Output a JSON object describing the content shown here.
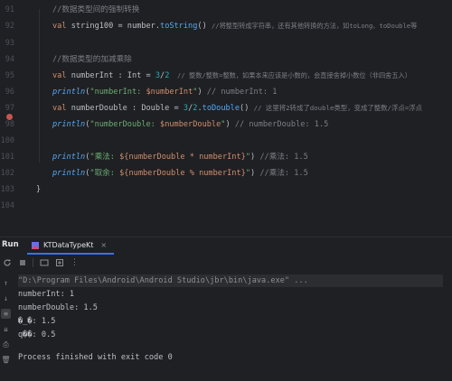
{
  "editor": {
    "line_numbers": [
      "91",
      "92",
      "93",
      "94",
      "95",
      "96",
      "97",
      "98",
      "99",
      "100",
      "101",
      "102",
      "103",
      "104"
    ],
    "lines": {
      "l91": {
        "comment": "//数据类型间的强制转换"
      },
      "l92": {
        "kw": "val",
        "name": " string100 = number.",
        "fn": "toString",
        "rest": "() ",
        "comment": "//将整型转成字符串，还有其他转换的方法，如toLong、toDouble等"
      },
      "l94": {
        "comment": "//数据类型的加减乘除"
      },
      "l95": {
        "kw": "val",
        "name": " numberInt : Int = ",
        "n1": "3",
        "op": "/",
        "n2": "2",
        "comment": "  // 整数/整数=整数，如果本来应该是小数的，会直接舍掉小数位（非四舍五入）"
      },
      "l96": {
        "fn": "println",
        "open": "(",
        "s1": "\"numberInt: ",
        "t": "$numberInt",
        "s2": "\"",
        "close": ") ",
        "comment": "// numberInt: 1"
      },
      "l98": {
        "kw": "val",
        "name": " numberDouble : Double = ",
        "n1": "3",
        "op": "/",
        "n2": "2",
        "mid": ".",
        "fn": "toDouble",
        "rest": "() ",
        "comment": "// 这里将2转成了double类型，变成了整数/浮点=浮点"
      },
      "l99": {
        "fn": "println",
        "open": "(",
        "s1": "\"numberDouble: ",
        "t": "$numberDouble",
        "s2": "\"",
        "close": ") ",
        "comment": "// numberDouble: 1.5"
      },
      "l101": {
        "fn": "println",
        "open": "(",
        "s1": "\"乘法: ",
        "t": "${numberDouble * numberInt}",
        "s2": "\"",
        "close": ") ",
        "comment": "//乘法: 1.5"
      },
      "l102": {
        "fn": "println",
        "open": "(",
        "s1": "\"取余: ",
        "t": "${numberDouble % numberInt}",
        "s2": "\"",
        "close": ") ",
        "comment": "//乘法: 1.5"
      },
      "l103": {
        "text": "}"
      }
    }
  },
  "run_panel": {
    "title": "Run",
    "tab_label": "KTDataTypeKt",
    "tab_close": "×",
    "console": [
      "\"D:\\Program Files\\Android\\Android Studio\\jbr\\bin\\java.exe\" ...",
      "numberInt: 1",
      "numberDouble: 1.5",
      "�_�: 1.5",
      "q��: 0.5",
      "",
      "Process finished with exit code 0"
    ]
  },
  "colors": {
    "background": "#1f2023",
    "keyword": "#cf8e6d",
    "comment": "#7a7e85",
    "function": "#56a8f5",
    "string": "#6aab73",
    "number": "#2aacb8",
    "breakpoint": "#c75450",
    "tab_underline": "#3574f0"
  },
  "icons": {
    "run_tab": "kotlin-run-icon",
    "toolbar": [
      "rerun-icon",
      "stop-icon",
      "debug-icon",
      "screenshot-icon",
      "more-icon"
    ],
    "side": [
      "up-arrow-icon",
      "down-arrow-icon",
      "soft-wrap-icon",
      "scroll-to-end-icon",
      "print-icon",
      "delete-icon"
    ]
  }
}
